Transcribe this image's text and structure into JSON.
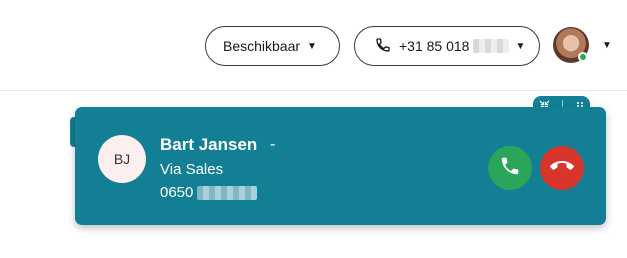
{
  "topbar": {
    "status_label": "Beschikbaar",
    "phone_number": "+31 85 018"
  },
  "call_card": {
    "caller_initials": "BJ",
    "caller_name": "Bart Jansen",
    "caller_dash": "-",
    "via_label": "Via Sales",
    "caller_number_prefix": "0650"
  },
  "colors": {
    "card_bg": "#137f94",
    "accept": "#2aa55a",
    "decline": "#d9362b",
    "online": "#22b14c"
  },
  "icons": {
    "phone": "phone-icon",
    "minimize": "minimize-icon",
    "drag": "drag-handle-icon",
    "accept": "phone-accept-icon",
    "decline": "phone-hangup-icon"
  }
}
